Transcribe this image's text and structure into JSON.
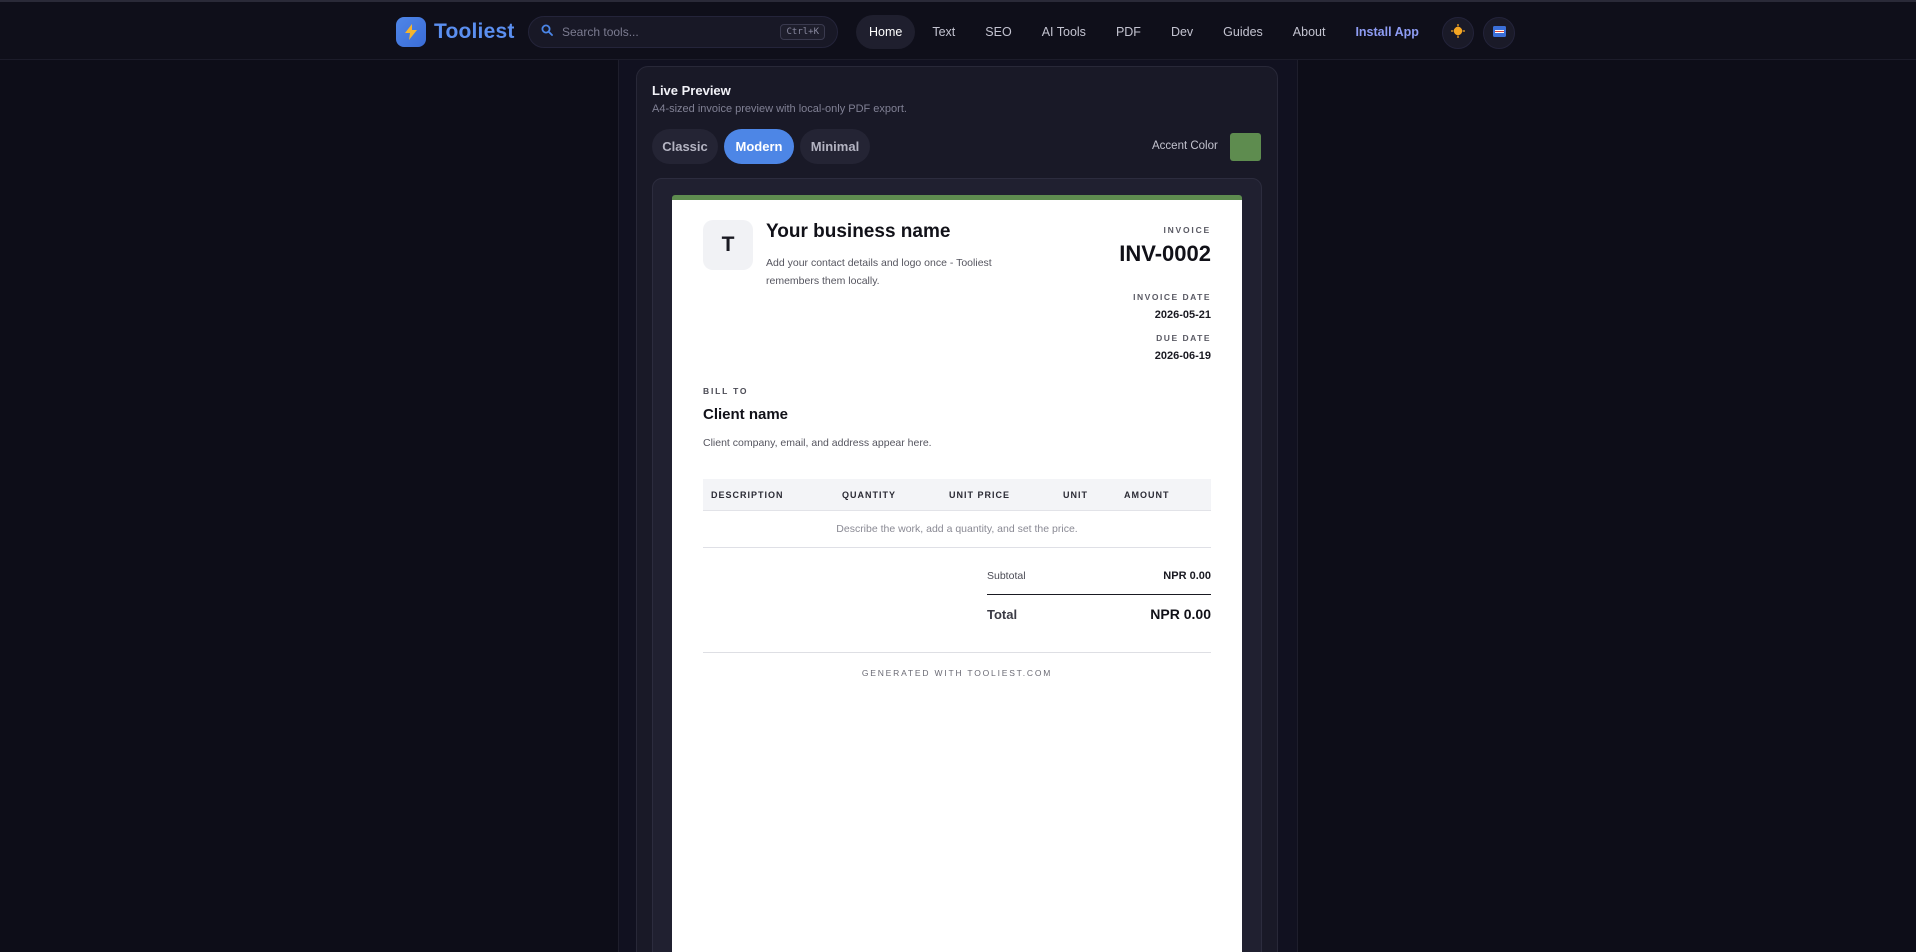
{
  "header": {
    "app_name": "Tooliest",
    "search": {
      "placeholder": "Search tools...",
      "shortcut": "Ctrl+K"
    },
    "nav": [
      {
        "label": "Home",
        "active": true
      },
      {
        "label": "Text"
      },
      {
        "label": "SEO"
      },
      {
        "label": "AI Tools"
      },
      {
        "label": "PDF"
      },
      {
        "label": "Dev"
      },
      {
        "label": "Guides"
      },
      {
        "label": "About"
      },
      {
        "label": "Install App"
      }
    ],
    "icons": [
      "bolt-icon",
      "search-icon",
      "sun-icon",
      "language-flag-icon"
    ]
  },
  "preview": {
    "title": "Live Preview",
    "subtitle": "A4-sized invoice preview with local-only PDF export.",
    "templates": [
      {
        "label": "Classic"
      },
      {
        "label": "Modern",
        "active": true
      },
      {
        "label": "Minimal"
      }
    ],
    "accent_label": "Accent Color",
    "accent_color": "#5e8c4f"
  },
  "invoice": {
    "logo_letter": "T",
    "business_name": "Your business name",
    "business_sub": "Add your contact details and logo once - Tooliest remembers them locally.",
    "invoice_label": "INVOICE",
    "invoice_number": "INV-0002",
    "invoice_date_label": "INVOICE DATE",
    "invoice_date": "2026-05-21",
    "due_date_label": "DUE DATE",
    "due_date": "2026-06-19",
    "bill_to_label": "BILL TO",
    "client_name": "Client name",
    "client_sub": "Client company, email, and address appear here.",
    "columns": [
      "DESCRIPTION",
      "QUANTITY",
      "UNIT PRICE",
      "UNIT",
      "AMOUNT"
    ],
    "empty_row": "Describe the work, add a quantity, and set the price.",
    "subtotal_label": "Subtotal",
    "subtotal_value": "NPR 0.00",
    "total_label": "Total",
    "total_value": "NPR 0.00",
    "footer": "GENERATED WITH TOOLIEST.COM"
  }
}
